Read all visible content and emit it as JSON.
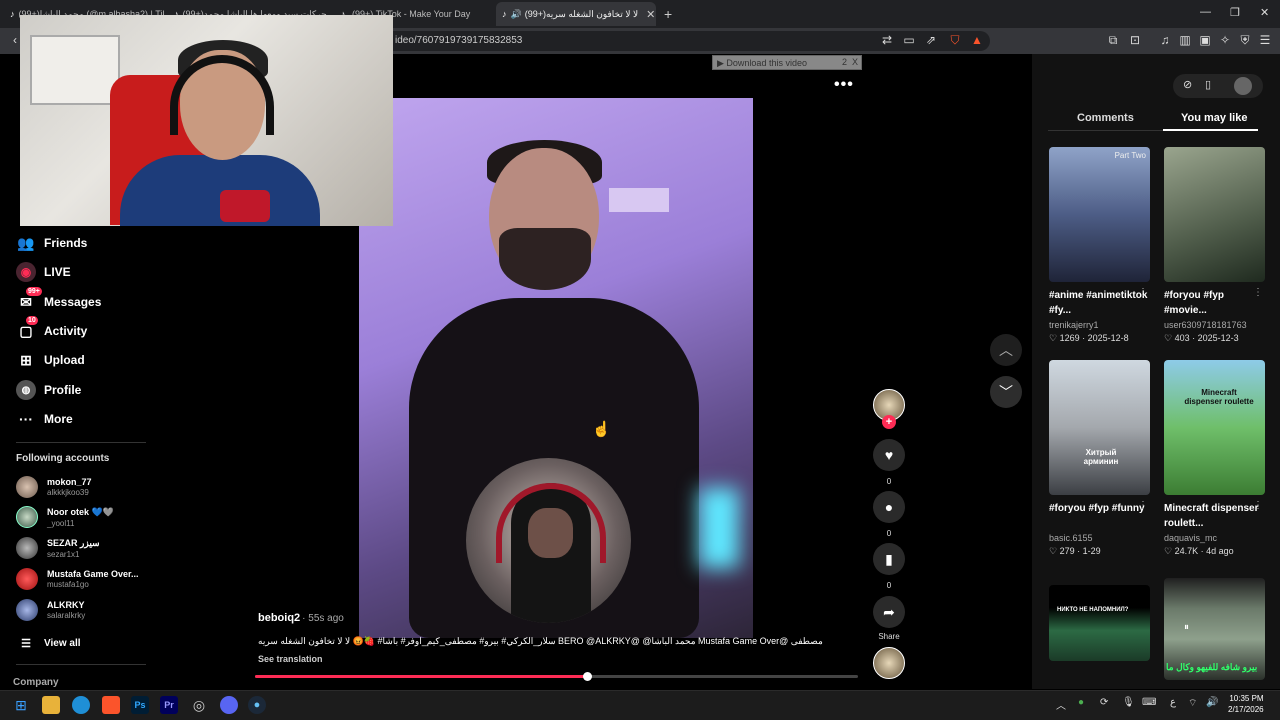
{
  "browser": {
    "tabs": [
      {
        "label": "(99+)محمد الباشا (@m.albasha2) | Tik"
      },
      {
        "label": "(99+)حركات سيد ومعها ها الباشا محمد"
      },
      {
        "label": "(99+) TikTok - Make Your Day"
      },
      {
        "label": "(99+)لا لا تخافون الشغله سريه"
      }
    ],
    "new_tab": "+",
    "url": "ideo/7607919739175832853",
    "window_controls": [
      "—",
      "❐",
      "✕"
    ]
  },
  "download_bar": {
    "label": "▶ Download this video",
    "count": "2",
    "close": "X"
  },
  "sidebar": {
    "nav": [
      {
        "label": "Friends",
        "icon": "friends-icon",
        "glyph": "👥"
      },
      {
        "label": "LIVE",
        "icon": "live-icon",
        "glyph": "◉"
      },
      {
        "label": "Messages",
        "icon": "messages-icon",
        "glyph": "✉",
        "badge": "99+"
      },
      {
        "label": "Activity",
        "icon": "activity-icon",
        "glyph": "💬",
        "badge": "10"
      },
      {
        "label": "Upload",
        "icon": "upload-icon",
        "glyph": "⊞"
      },
      {
        "label": "Profile",
        "icon": "profile-icon",
        "glyph": "◍"
      },
      {
        "label": "More",
        "icon": "more-icon",
        "glyph": "···"
      }
    ],
    "following_title": "Following accounts",
    "accounts": [
      {
        "name": "mokon_77",
        "user": "alkkkjkoo39"
      },
      {
        "name": "Noor otek 💙🩶",
        "user": "_yool11"
      },
      {
        "name": "SEZAR سيزر",
        "user": "sezar1x1"
      },
      {
        "name": "Mustafa Game Over...",
        "user": "mustafa1go"
      },
      {
        "name": "ALKRKY",
        "user": "salaralkrky"
      }
    ],
    "view_all": "View all",
    "company": "Company"
  },
  "video": {
    "more": "•••",
    "author": "beboiq2",
    "time_ago": "· 55s ago",
    "caption": "مصطفى @Mustafa Game Over محمد الباشا@ @BERO @ALKRKY سلار_الكركي# بيرو# مصطفى_كيم_اوفر# باشا# 🍓😡 لا لا تخافون الشغله سريه",
    "see_translation": "See translation",
    "progress": 0.55,
    "likes": "0",
    "comments": "0",
    "saves": "0",
    "share_label": "Share"
  },
  "right_panel": {
    "tabs": [
      "Comments",
      "You may like"
    ],
    "active_tab": "You may like",
    "cards": [
      {
        "caption": "#anime #animetiktok #fy...",
        "author": "trenikajerry1",
        "likes": "1269",
        "date": "2025-12-8",
        "thumb_text": "Part Two"
      },
      {
        "caption": "#foryou #fyp #movie...",
        "author": "user6309718181763",
        "likes": "403",
        "date": "2025-12-3",
        "thumb_text": ""
      },
      {
        "caption": "#foryou #fyp #funny",
        "author": "basic.6155",
        "likes": "279",
        "date": "1-29",
        "thumb_text": "Хитрый арминин"
      },
      {
        "caption": "Minecraft dispenser roulett...",
        "author": "daquavis_mc",
        "likes": "24.7K",
        "date": "4d ago",
        "thumb_text": "Minecraft dispenser roulette"
      },
      {
        "caption": "",
        "author": "",
        "likes": "",
        "date": "",
        "thumb_text": "НИКТО НЕ НАПОМНИЛ?"
      },
      {
        "caption": "",
        "author": "",
        "likes": "",
        "date": "",
        "thumb_text": "بيرو شافه للفيهو وكال ما"
      }
    ]
  },
  "taskbar": {
    "time": "10:35 PM",
    "date": "2/17/2026",
    "lang": "ع"
  },
  "colors": {
    "accent": "#fe2c55",
    "background": "#000000",
    "panel": "#121212"
  }
}
